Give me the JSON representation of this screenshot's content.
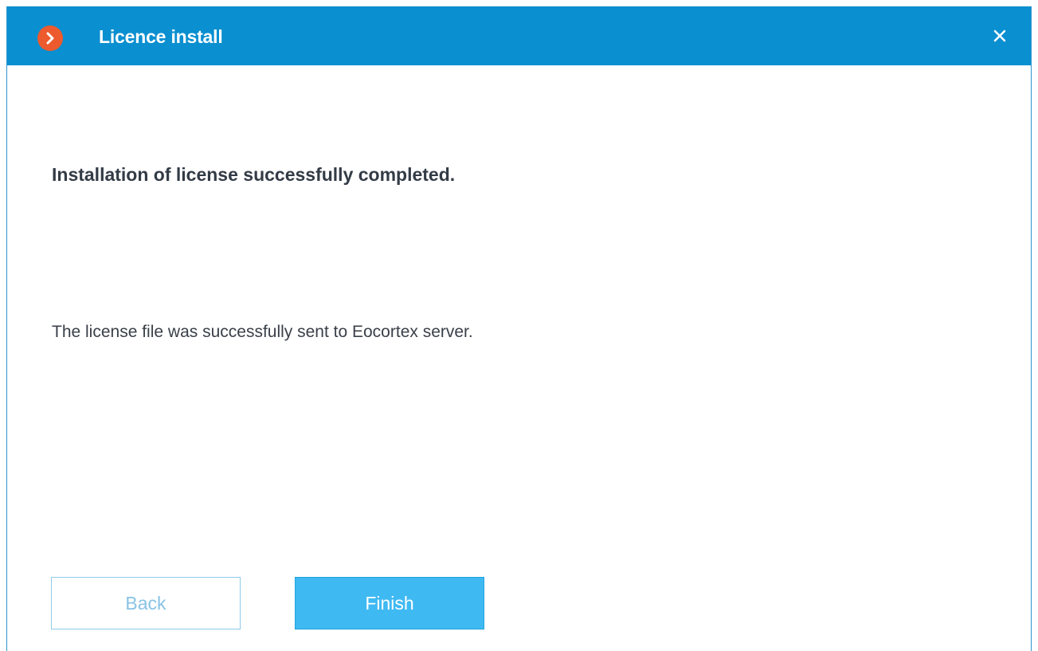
{
  "window": {
    "title": "Licence install",
    "logo_icon": "chevron-right-icon",
    "close_icon": "close-icon",
    "titlebar_color": "#0a8fd0",
    "logo_color": "#ec5a2d"
  },
  "main": {
    "heading": "Installation of license successfully completed.",
    "message": "The license file was successfully sent to Eocortex server."
  },
  "buttons": {
    "back_label": "Back",
    "finish_label": "Finish",
    "finish_color": "#3fb9f2"
  }
}
